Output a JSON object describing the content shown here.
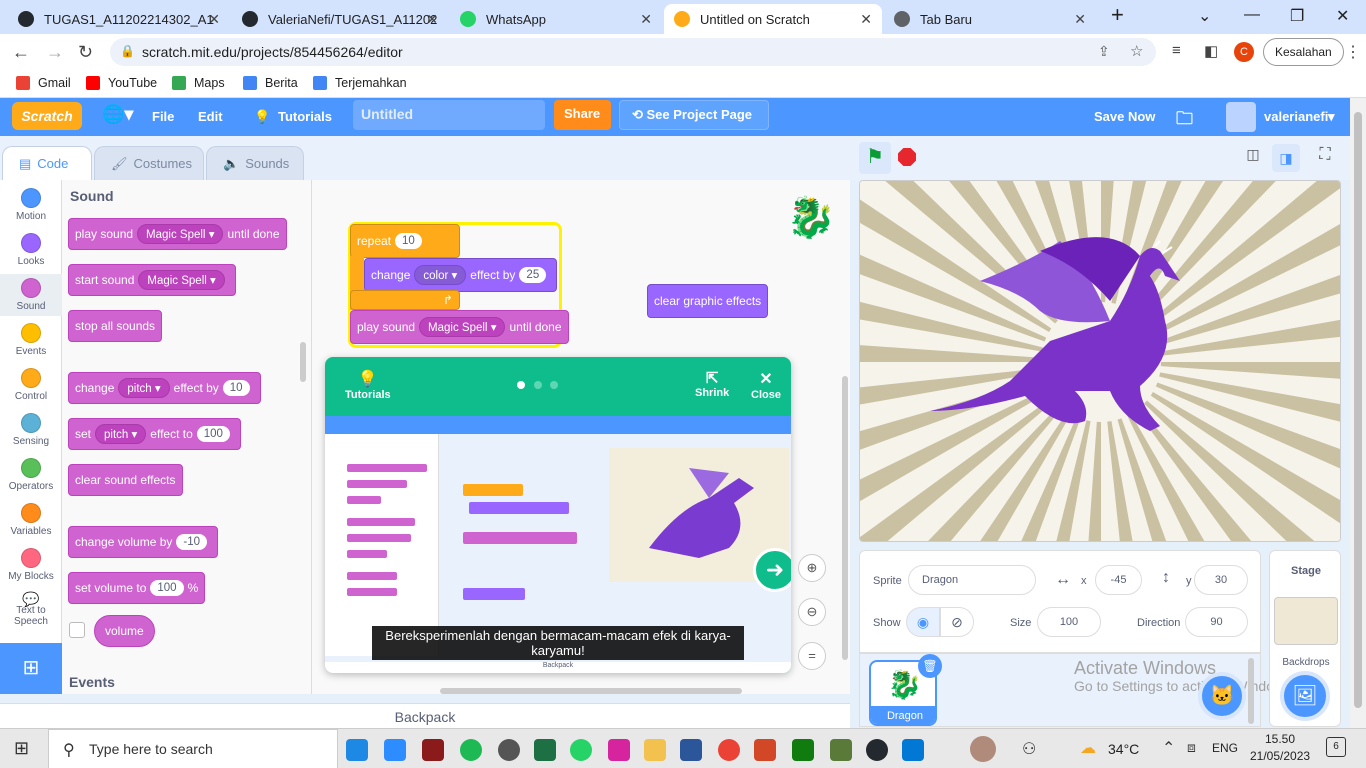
{
  "browser": {
    "tabs": [
      {
        "title": "TUGAS1_A11202214302_A11",
        "color": "#24292f"
      },
      {
        "title": "ValeriaNefi/TUGAS1_A11202",
        "color": "#24292f"
      },
      {
        "title": "WhatsApp",
        "color": "#25d366"
      },
      {
        "title": "Untitled on Scratch",
        "color": "#ffab19"
      },
      {
        "title": "Tab Baru",
        "color": "#5f6368"
      }
    ],
    "url": "scratch.mit.edu/projects/854456264/editor",
    "profile_initial": "C",
    "error_label": "Kesalahan",
    "bookmarks": [
      "Gmail",
      "YouTube",
      "Maps",
      "Berita",
      "Terjemahkan"
    ]
  },
  "scratch": {
    "logo": "Scratch",
    "menu": {
      "file": "File",
      "edit": "Edit",
      "tutorials": "Tutorials",
      "title": "Untitled",
      "share": "Share",
      "see_project": "See Project Page",
      "save_now": "Save Now",
      "user": "valerianefi"
    },
    "tabs": {
      "code": "Code",
      "costumes": "Costumes",
      "sounds": "Sounds"
    },
    "categories": [
      {
        "label": "Motion",
        "color": "#4c97ff"
      },
      {
        "label": "Looks",
        "color": "#9966ff"
      },
      {
        "label": "Sound",
        "color": "#cf63cf"
      },
      {
        "label": "Events",
        "color": "#ffbf00"
      },
      {
        "label": "Control",
        "color": "#ffab19"
      },
      {
        "label": "Sensing",
        "color": "#5cb1d6"
      },
      {
        "label": "Operators",
        "color": "#59c059"
      },
      {
        "label": "Variables",
        "color": "#ff8c1a"
      },
      {
        "label": "My Blocks",
        "color": "#ff6680"
      }
    ],
    "ext_label": "Text to Speech",
    "palette": {
      "heading": "Sound",
      "play_sound": "play sound",
      "sound_name": "Magic Spell",
      "until_done": "until done",
      "start_sound": "start sound",
      "stop_all": "stop all sounds",
      "change": "change",
      "pitch": "pitch",
      "effect_by": "effect by",
      "effect_by_val": "10",
      "set": "set",
      "effect_to": "effect to",
      "effect_to_val": "100",
      "clear_sound": "clear sound effects",
      "change_volume": "change volume by",
      "change_volume_val": "-10",
      "set_volume": "set volume to",
      "set_volume_val": "100",
      "percent": "%",
      "volume": "volume",
      "events_heading": "Events"
    },
    "script": {
      "repeat": "repeat",
      "repeat_val": "10",
      "change": "change",
      "color": "color",
      "effect_by": "effect by",
      "effect_val": "25",
      "play_sound": "play sound",
      "sound_name": "Magic Spell",
      "until_done": "until done",
      "clear_graphic": "clear graphic effects"
    },
    "tutorial": {
      "label": "Tutorials",
      "shrink": "Shrink",
      "close": "Close",
      "caption": "Bereksperimenlah dengan bermacam-macam efek di karya-karyamu!",
      "mini_backpack": "Backpack"
    },
    "sprite": {
      "sprite_label": "Sprite",
      "name": "Dragon",
      "x_label": "x",
      "x": "-45",
      "y_label": "y",
      "y": "30",
      "show_label": "Show",
      "size_label": "Size",
      "size": "100",
      "direction_label": "Direction",
      "direction": "90",
      "thumb_name": "Dragon"
    },
    "stage_panel": {
      "title": "Stage",
      "backdrops": "Backdrops"
    },
    "backpack": "Backpack",
    "watermark": {
      "line1": "Activate Windows",
      "line2": "Go to Settings to activate Windows."
    }
  },
  "taskbar": {
    "search_placeholder": "Type here to search",
    "weather": "34°C",
    "lang": "ENG",
    "time": "15.50",
    "date": "21/05/2023",
    "notif": "6"
  }
}
